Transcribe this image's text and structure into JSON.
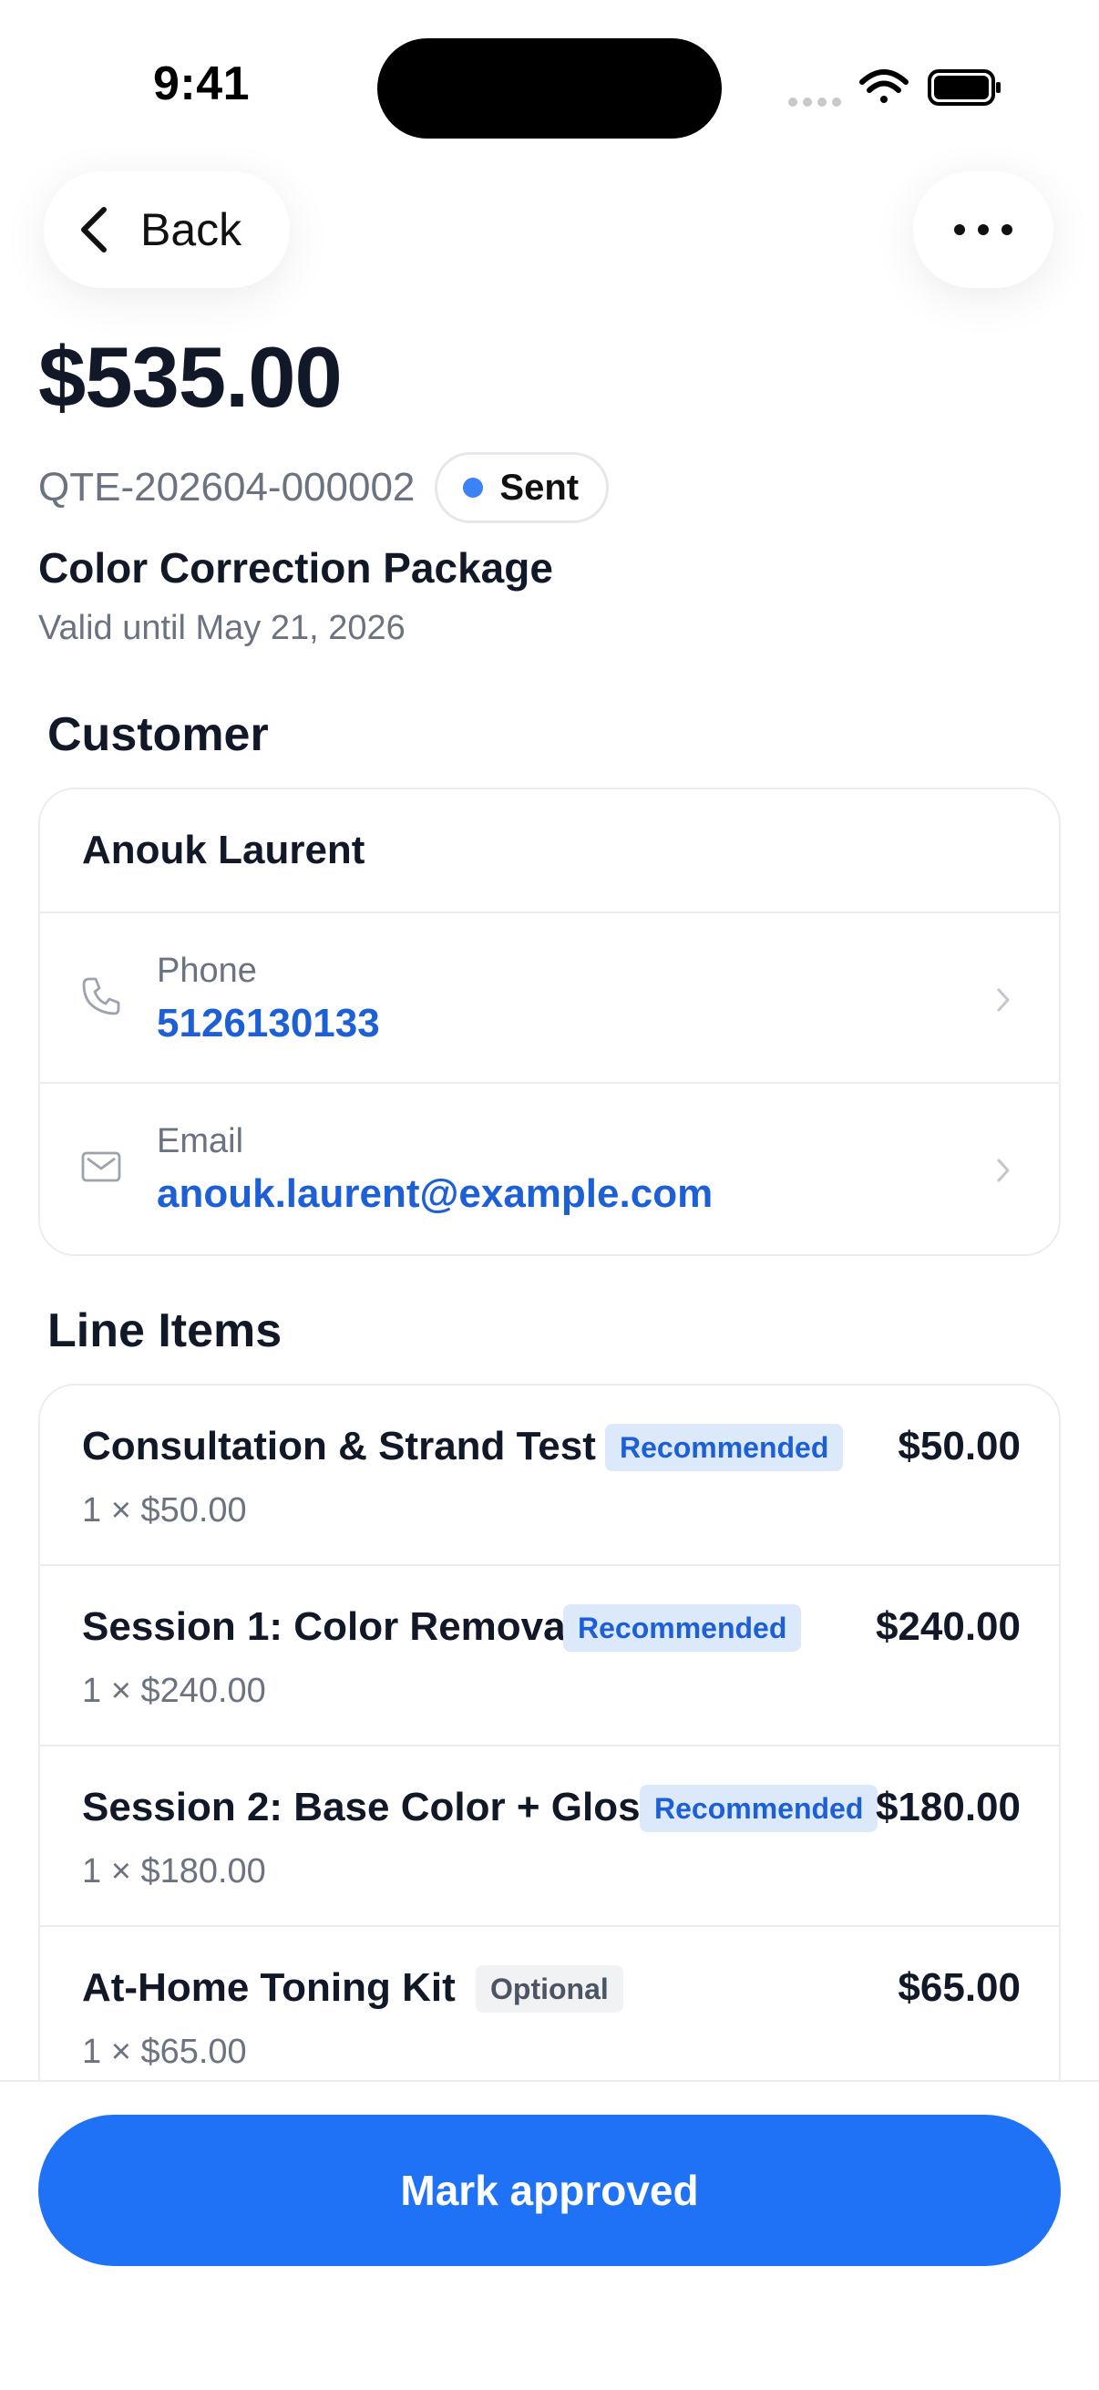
{
  "status_bar": {
    "time": "9:41"
  },
  "nav": {
    "back_label": "Back"
  },
  "quote": {
    "amount": "$535.00",
    "number": "QTE-202604-000002",
    "status": "Sent",
    "status_color": "#3b82f6",
    "title": "Color Correction Package",
    "valid_until": "Valid until May 21, 2026"
  },
  "customer": {
    "heading": "Customer",
    "name": "Anouk Laurent",
    "phone_label": "Phone",
    "phone": "5126130133",
    "email_label": "Email",
    "email": "anouk.laurent@example.com"
  },
  "line_items": {
    "heading": "Line Items",
    "items": [
      {
        "name": "Consultation & Strand Test",
        "badge": "Recommended",
        "price": "$50.00",
        "qty": "1 × $50.00"
      },
      {
        "name": "Session 1: Color Removal",
        "badge": "Recommended",
        "price": "$240.00",
        "qty": "1 × $240.00"
      },
      {
        "name": "Session 2: Base Color + Gloss",
        "badge": "Recommended",
        "price": "$180.00",
        "qty": "1 × $180.00"
      },
      {
        "name": "At-Home Toning Kit",
        "badge": "Optional",
        "price": "$65.00",
        "qty": "1 × $65.00"
      }
    ]
  },
  "actions": {
    "primary_label": "Mark approved",
    "primary_color": "#1f72f5"
  }
}
